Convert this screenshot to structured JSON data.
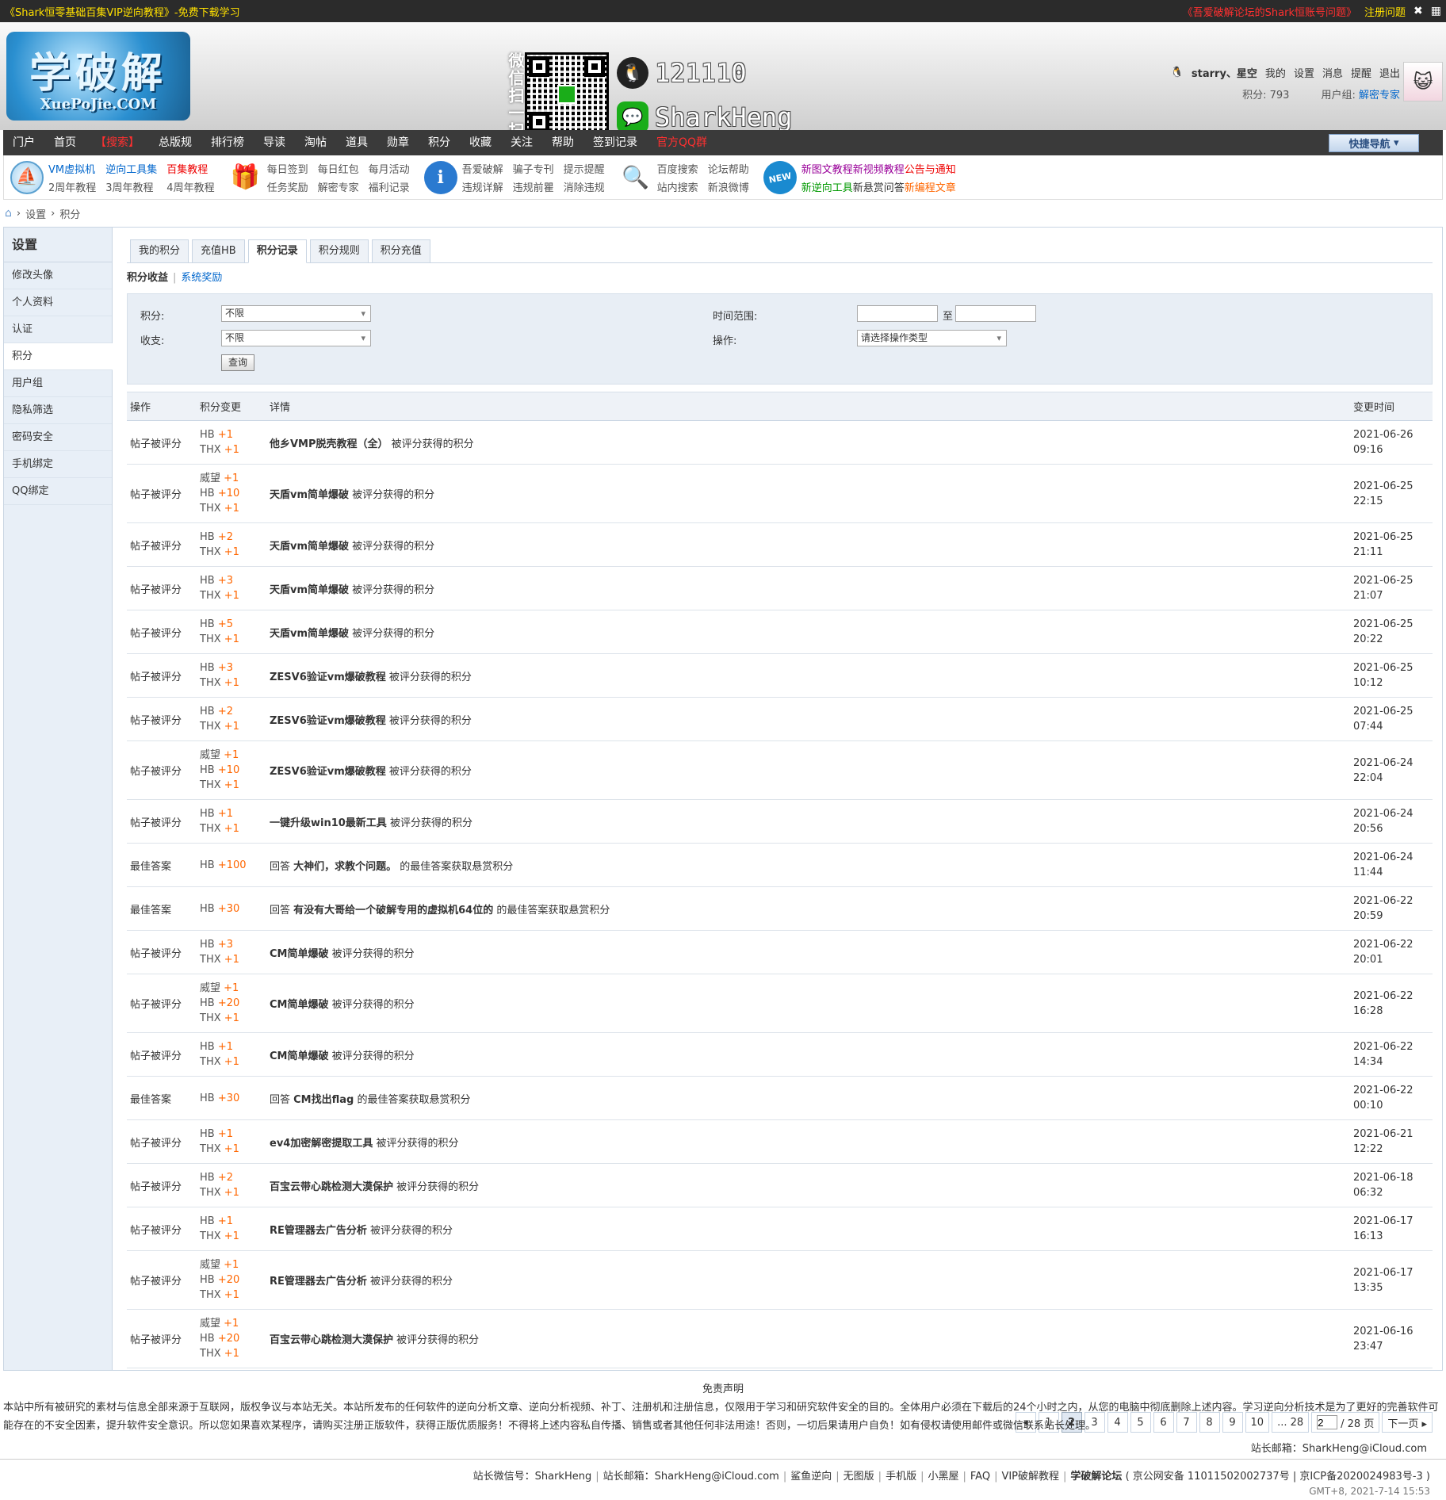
{
  "topbar": {
    "promo": "《Shark恒零基础百集VIP逆向教程》-免费下载学习",
    "notice": "《吾爱破解论坛的Shark恒账号问题》",
    "register_help": "注册问题"
  },
  "header": {
    "logo_main": "学破解",
    "logo_sub": "XuePoJie.COM",
    "qr_label": "微信扫一扫",
    "qq_number": "121110",
    "wechat_name": "SharkHeng"
  },
  "user": {
    "name": "starry、星空",
    "my": "我的",
    "settings": "设置",
    "messages": "消息",
    "reminders": "提醒",
    "logout": "退出",
    "points_label": "积分: 793",
    "group_label": "用户组:",
    "group_value": "解密专家"
  },
  "nav": {
    "items": [
      "门户",
      "首页",
      "【搜索】",
      "总版规",
      "排行榜",
      "导读",
      "淘帖",
      "道具",
      "勋章",
      "积分",
      "收藏",
      "关注",
      "帮助",
      "签到记录",
      "官方QQ群"
    ],
    "quick": "快捷导航"
  },
  "quicklinks": {
    "g1": [
      "VM虚拟机",
      "逆向工具集",
      "百集教程",
      "2周年教程",
      "3周年教程",
      "4周年教程"
    ],
    "g2": [
      "每日签到",
      "每日红包",
      "每月活动",
      "任务奖励",
      "解密专家",
      "福利记录"
    ],
    "g3": [
      "吾爱破解",
      "骗子专刊",
      "提示提醒",
      "违规详解",
      "违规前瞿",
      "消除违规"
    ],
    "g4": [
      "百度搜索",
      "论坛帮助",
      "站内搜索",
      "新浪微博"
    ],
    "g5a": [
      "新图文教程",
      "新视频教程",
      "公告与通知"
    ],
    "g5b": [
      "新逆向工具",
      "新悬赏问答",
      "新编程文章"
    ],
    "new_badge": "NEW"
  },
  "breadcrumb": [
    "设置",
    "积分"
  ],
  "sidebar": {
    "title": "设置",
    "items": [
      "修改头像",
      "个人资料",
      "认证",
      "积分",
      "用户组",
      "隐私筛选",
      "密码安全",
      "手机绑定",
      "QQ绑定"
    ]
  },
  "tabs": [
    "我的积分",
    "充值HB",
    "积分记录",
    "积分规则",
    "积分充值"
  ],
  "subtabs": [
    "积分收益",
    "系统奖励"
  ],
  "filter": {
    "points_label": "积分:",
    "points_value": "不限",
    "inout_label": "收支:",
    "inout_value": "不限",
    "query": "查询",
    "time_label": "时间范围:",
    "to": "至",
    "op_label": "操作:",
    "op_value": "请选择操作类型"
  },
  "table": {
    "headers": [
      "操作",
      "积分变更",
      "详情",
      "变更时间"
    ],
    "rows": [
      {
        "op": "帖子被评分",
        "changes": [
          [
            "HB",
            "+1"
          ],
          [
            "THX",
            "+1"
          ]
        ],
        "pre": "",
        "title": "他乡VMP脱壳教程（全）",
        "suffix": " 被评分获得的积分",
        "date": "2021-06-26",
        "time": "09:16"
      },
      {
        "op": "帖子被评分",
        "changes": [
          [
            "威望",
            "+1"
          ],
          [
            "HB",
            "+10"
          ],
          [
            "THX",
            "+1"
          ]
        ],
        "pre": "",
        "title": "天盾vm简单爆破",
        "suffix": " 被评分获得的积分",
        "date": "2021-06-25",
        "time": "22:15"
      },
      {
        "op": "帖子被评分",
        "changes": [
          [
            "HB",
            "+2"
          ],
          [
            "THX",
            "+1"
          ]
        ],
        "pre": "",
        "title": "天盾vm简单爆破",
        "suffix": " 被评分获得的积分",
        "date": "2021-06-25",
        "time": "21:11"
      },
      {
        "op": "帖子被评分",
        "changes": [
          [
            "HB",
            "+3"
          ],
          [
            "THX",
            "+1"
          ]
        ],
        "pre": "",
        "title": "天盾vm简单爆破",
        "suffix": " 被评分获得的积分",
        "date": "2021-06-25",
        "time": "21:07"
      },
      {
        "op": "帖子被评分",
        "changes": [
          [
            "HB",
            "+5"
          ],
          [
            "THX",
            "+1"
          ]
        ],
        "pre": "",
        "title": "天盾vm简单爆破",
        "suffix": " 被评分获得的积分",
        "date": "2021-06-25",
        "time": "20:22"
      },
      {
        "op": "帖子被评分",
        "changes": [
          [
            "HB",
            "+3"
          ],
          [
            "THX",
            "+1"
          ]
        ],
        "pre": "",
        "title": "ZESV6验证vm爆破教程",
        "suffix": " 被评分获得的积分",
        "date": "2021-06-25",
        "time": "10:12"
      },
      {
        "op": "帖子被评分",
        "changes": [
          [
            "HB",
            "+2"
          ],
          [
            "THX",
            "+1"
          ]
        ],
        "pre": "",
        "title": "ZESV6验证vm爆破教程",
        "suffix": " 被评分获得的积分",
        "date": "2021-06-25",
        "time": "07:44"
      },
      {
        "op": "帖子被评分",
        "changes": [
          [
            "威望",
            "+1"
          ],
          [
            "HB",
            "+10"
          ],
          [
            "THX",
            "+1"
          ]
        ],
        "pre": "",
        "title": "ZESV6验证vm爆破教程",
        "suffix": " 被评分获得的积分",
        "date": "2021-06-24",
        "time": "22:04"
      },
      {
        "op": "帖子被评分",
        "changes": [
          [
            "HB",
            "+1"
          ],
          [
            "THX",
            "+1"
          ]
        ],
        "pre": "",
        "title": "一键升级win10最新工具",
        "suffix": " 被评分获得的积分",
        "date": "2021-06-24",
        "time": "20:56"
      },
      {
        "op": "最佳答案",
        "changes": [
          [
            "HB",
            "+100"
          ]
        ],
        "pre": "回答 ",
        "title": "大神们，求教个问题。",
        "suffix": " 的最佳答案获取悬赏积分",
        "date": "2021-06-24",
        "time": "11:44"
      },
      {
        "op": "最佳答案",
        "changes": [
          [
            "HB",
            "+30"
          ]
        ],
        "pre": "回答 ",
        "title": "有没有大哥给一个破解专用的虚拟机64位的",
        "suffix": " 的最佳答案获取悬赏积分",
        "date": "2021-06-22",
        "time": "20:59"
      },
      {
        "op": "帖子被评分",
        "changes": [
          [
            "HB",
            "+3"
          ],
          [
            "THX",
            "+1"
          ]
        ],
        "pre": "",
        "title": "CM简单爆破",
        "suffix": " 被评分获得的积分",
        "date": "2021-06-22",
        "time": "20:01"
      },
      {
        "op": "帖子被评分",
        "changes": [
          [
            "威望",
            "+1"
          ],
          [
            "HB",
            "+20"
          ],
          [
            "THX",
            "+1"
          ]
        ],
        "pre": "",
        "title": "CM简单爆破",
        "suffix": " 被评分获得的积分",
        "date": "2021-06-22",
        "time": "16:28"
      },
      {
        "op": "帖子被评分",
        "changes": [
          [
            "HB",
            "+1"
          ],
          [
            "THX",
            "+1"
          ]
        ],
        "pre": "",
        "title": "CM简单爆破",
        "suffix": " 被评分获得的积分",
        "date": "2021-06-22",
        "time": "14:34"
      },
      {
        "op": "最佳答案",
        "changes": [
          [
            "HB",
            "+30"
          ]
        ],
        "pre": "回答 ",
        "title": "CM找出flag",
        "suffix": " 的最佳答案获取悬赏积分",
        "date": "2021-06-22",
        "time": "00:10"
      },
      {
        "op": "帖子被评分",
        "changes": [
          [
            "HB",
            "+1"
          ],
          [
            "THX",
            "+1"
          ]
        ],
        "pre": "",
        "title": "ev4加密解密提取工具",
        "suffix": " 被评分获得的积分",
        "date": "2021-06-21",
        "time": "12:22"
      },
      {
        "op": "帖子被评分",
        "changes": [
          [
            "HB",
            "+2"
          ],
          [
            "THX",
            "+1"
          ]
        ],
        "pre": "",
        "title": "百宝云带心跳检测大漠保护",
        "suffix": " 被评分获得的积分",
        "date": "2021-06-18",
        "time": "06:32"
      },
      {
        "op": "帖子被评分",
        "changes": [
          [
            "HB",
            "+1"
          ],
          [
            "THX",
            "+1"
          ]
        ],
        "pre": "",
        "title": "RE管理器去广告分析",
        "suffix": " 被评分获得的积分",
        "date": "2021-06-17",
        "time": "16:13"
      },
      {
        "op": "帖子被评分",
        "changes": [
          [
            "威望",
            "+1"
          ],
          [
            "HB",
            "+20"
          ],
          [
            "THX",
            "+1"
          ]
        ],
        "pre": "",
        "title": "RE管理器去广告分析",
        "suffix": " 被评分获得的积分",
        "date": "2021-06-17",
        "time": "13:35"
      },
      {
        "op": "帖子被评分",
        "changes": [
          [
            "威望",
            "+1"
          ],
          [
            "HB",
            "+20"
          ],
          [
            "THX",
            "+1"
          ]
        ],
        "pre": "",
        "title": "百宝云带心跳检测大漠保护",
        "suffix": " 被评分获得的积分",
        "date": "2021-06-16",
        "time": "23:47"
      }
    ]
  },
  "pager": {
    "pages": [
      "1",
      "2",
      "3",
      "4",
      "5",
      "6",
      "7",
      "8",
      "9",
      "10",
      "... 28"
    ],
    "current": "2",
    "input_value": "2",
    "total": "/ 28 页",
    "next": "下一页"
  },
  "disclaimer": {
    "title": "免责声明",
    "text": "本站中所有被研究的素材与信息全部来源于互联网，版权争议与本站无关。本站所发布的任何软件的逆向分析文章、逆向分析视频、补丁、注册机和注册信息，仅限用于学习和研究软件安全的目的。全体用户必须在下载后的24个小时之内，从您的电脑中彻底删除上述内容。学习逆向分析技术是为了更好的完善软件可能存在的不安全因素，提升软件安全意识。所以您如果喜欢某程序，请购买注册正版软件，获得正版优质服务！不得将上述内容私自传播、销售或者其他任何非法用途！否则，一切后果请用户自负！如有侵权请使用邮件或微信联系站长处理。",
    "mail": "站长邮箱：SharkHeng@iCloud.com"
  },
  "footer": {
    "items": [
      "站长微信号：SharkHeng",
      "站长邮箱：SharkHeng@iCloud.com",
      "鲨鱼逆向",
      "无图版",
      "手机版",
      "小黑屋",
      "FAQ",
      "VIP破解教程"
    ],
    "site": "学破解论坛",
    "icp": "京公网安备 11011502002737号 | 京ICP备2020024983号-3",
    "time": "GMT+8, 2021-7-14 15:53"
  }
}
